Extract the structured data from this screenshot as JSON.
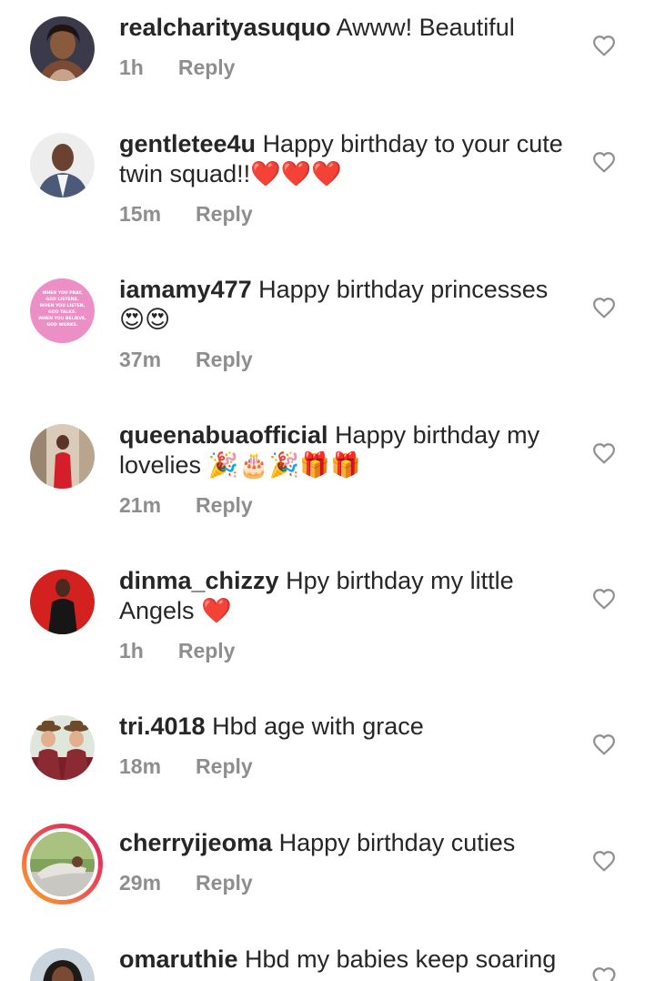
{
  "comments": [
    {
      "username": "realcharityasuquo",
      "text": "Awww! Beautiful",
      "time": "1h",
      "reply": "Reply",
      "avatar_icon": "woman-portrait"
    },
    {
      "username": "gentletee4u",
      "text": "Happy birthday to your cute twin squad!!❤️❤️❤️",
      "time": "15m",
      "reply": "Reply",
      "avatar_icon": "man-portrait"
    },
    {
      "username": "iamamy477",
      "text": "Happy birthday princesses 😍😍",
      "time": "37m",
      "reply": "Reply",
      "avatar_icon": "quote-card",
      "avatar_text": "WHEN YOU PRAY, GOD LISTENS. WHEN YOU LISTEN, GOD TALKS. WHEN YOU BELIEVE, GOD WORKS."
    },
    {
      "username": "queenabuaofficial",
      "text": "Happy birthday my lovelies 🎉🎂🎉🎁🎁",
      "time": "21m",
      "reply": "Reply",
      "avatar_icon": "woman-red-dress"
    },
    {
      "username": "dinma_chizzy",
      "text": "Hpy birthday my little Angels ❤️",
      "time": "1h",
      "reply": "Reply",
      "avatar_icon": "woman-red-background"
    },
    {
      "username": "tri.4018",
      "text": "Hbd age with grace",
      "time": "18m",
      "reply": "Reply",
      "avatar_icon": "children-with-hats"
    },
    {
      "username": "cherryijeoma",
      "text": "Happy birthday cuties",
      "time": "29m",
      "reply": "Reply",
      "avatar_icon": "woman-lying-outdoors"
    },
    {
      "username": "omaruthie",
      "text": "Hbd my babies keep soaring",
      "avatar_icon": "woman-portrait"
    }
  ],
  "colors": {
    "text": "#262626",
    "meta": "#8e8e8e",
    "like_outline": "#8e8e8e"
  },
  "icons": {
    "like": "heart-outline-icon"
  }
}
